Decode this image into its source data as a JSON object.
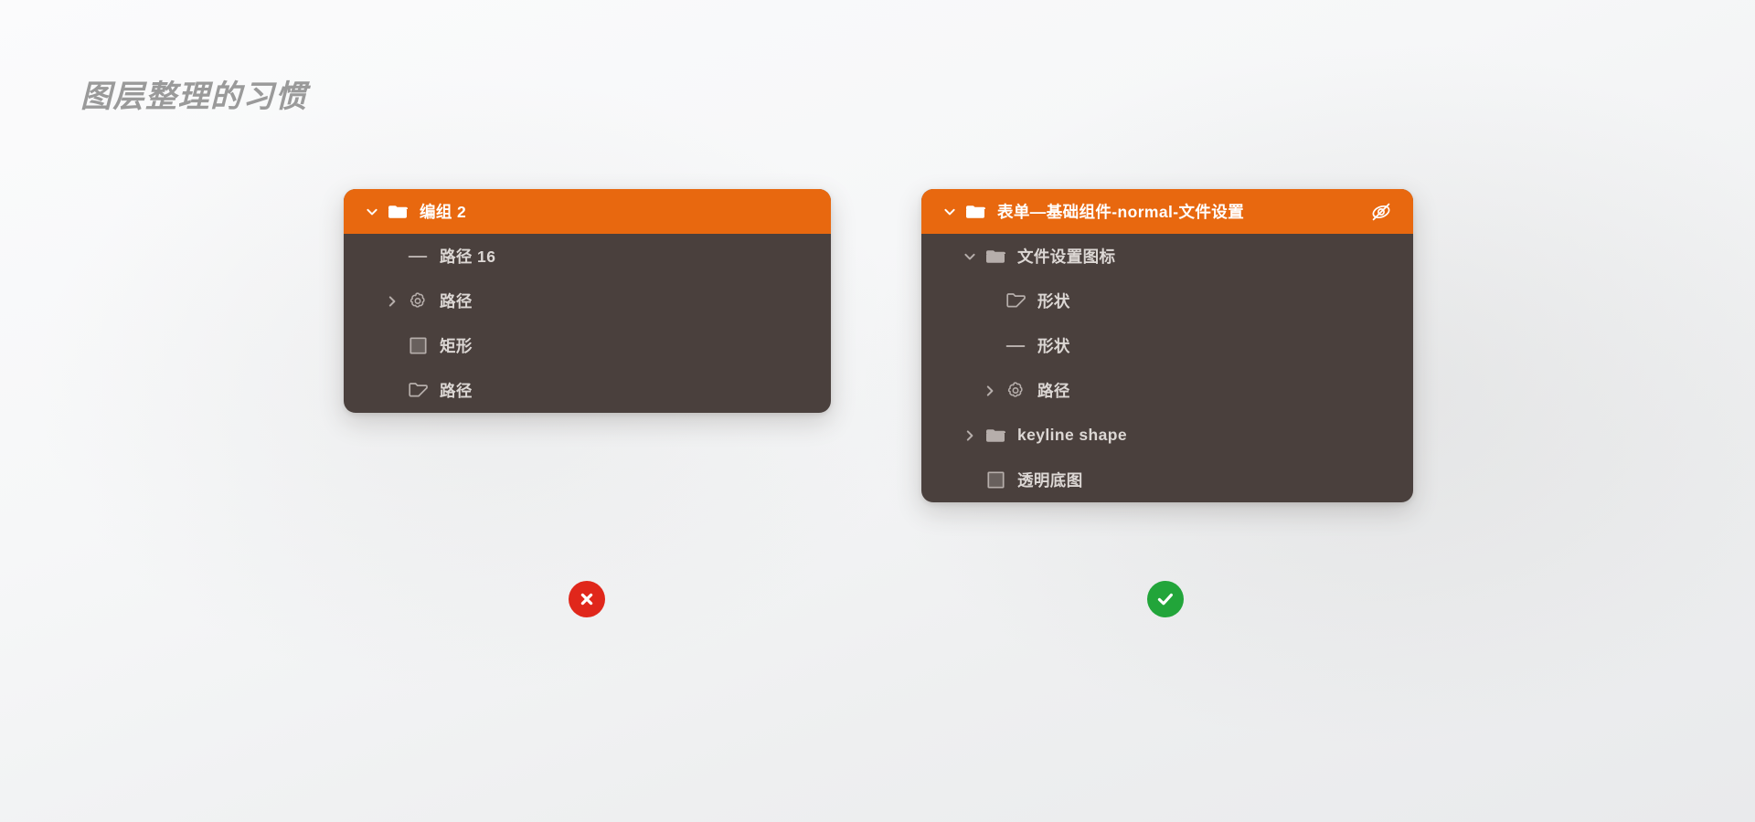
{
  "page": {
    "title": "图层整理的习惯",
    "title_color": "#9a9a9a",
    "background_color": "#f4f5f6"
  },
  "colors": {
    "panel_background": "#4a403d",
    "selected_row": "#e8680f",
    "row_text": "#dcd7d4",
    "selected_row_text": "#ffffff",
    "badge_bad": "#e0271b",
    "badge_good": "#22a53a"
  },
  "panels": [
    {
      "id": "bad-example",
      "verdict": "bad",
      "badge_icon": "cross-circle-icon",
      "rows": [
        {
          "label": "编组 2",
          "icon": "folder-filled-icon",
          "chevron": "chevron-down-icon",
          "indent": 0,
          "selected": true,
          "eye_icon": null
        },
        {
          "label": "路径 16",
          "icon": "line-icon",
          "chevron": null,
          "indent": 1,
          "selected": false,
          "eye_icon": null
        },
        {
          "label": "路径",
          "icon": "gear-icon",
          "chevron": "chevron-right-icon",
          "indent": 1,
          "selected": false,
          "eye_icon": null
        },
        {
          "label": "矩形",
          "icon": "rectangle-icon",
          "chevron": null,
          "indent": 1,
          "selected": false,
          "eye_icon": null
        },
        {
          "label": "路径",
          "icon": "shape-outline-icon",
          "chevron": null,
          "indent": 1,
          "selected": false,
          "eye_icon": null
        }
      ]
    },
    {
      "id": "good-example",
      "verdict": "good",
      "badge_icon": "check-circle-icon",
      "rows": [
        {
          "label": "表单—基础组件-normal-文件设置",
          "icon": "folder-filled-icon",
          "chevron": "chevron-down-icon",
          "indent": 0,
          "selected": true,
          "eye_icon": "eye-off-icon"
        },
        {
          "label": "文件设置图标",
          "icon": "folder-filled-icon",
          "chevron": "chevron-down-icon",
          "indent": 1,
          "selected": false,
          "eye_icon": null
        },
        {
          "label": "形状",
          "icon": "shape-outline-icon",
          "chevron": null,
          "indent": 2,
          "selected": false,
          "eye_icon": null
        },
        {
          "label": "形状",
          "icon": "line-icon",
          "chevron": null,
          "indent": 2,
          "selected": false,
          "eye_icon": null
        },
        {
          "label": "路径",
          "icon": "gear-icon",
          "chevron": "chevron-right-icon",
          "indent": 2,
          "selected": false,
          "eye_icon": null
        },
        {
          "label": "keyline shape",
          "icon": "folder-filled-icon",
          "chevron": "chevron-right-icon",
          "indent": 1,
          "selected": false,
          "eye_icon": null
        },
        {
          "label": "透明底图",
          "icon": "rectangle-icon",
          "chevron": null,
          "indent": 1,
          "selected": false,
          "eye_icon": null
        }
      ]
    }
  ]
}
